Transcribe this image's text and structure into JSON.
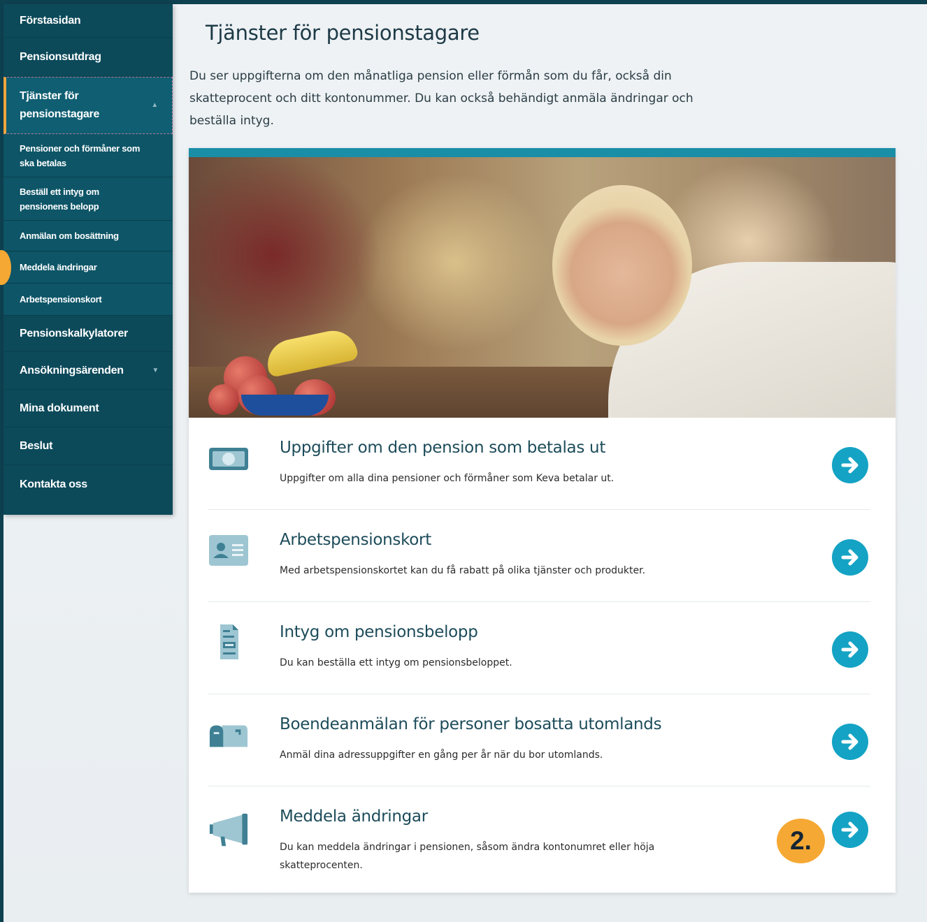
{
  "sidebar": {
    "items": [
      {
        "label": "Förstasidan"
      },
      {
        "label": "Pensionsutdrag"
      },
      {
        "label": "Tjänster för pensionstagare",
        "line1": "Tjänster för",
        "line2": "pensionstagare"
      },
      {
        "label": "Pensioner och förmåner som ska betalas",
        "line1": "Pensioner och förmåner som",
        "line2": "ska betalas"
      },
      {
        "label": "Beställ ett intyg om pensionens belopp",
        "line1": "Beställ ett intyg om",
        "line2": "pensionens belopp"
      },
      {
        "label": "Anmälan om bosättning"
      },
      {
        "label": "Meddela ändringar"
      },
      {
        "label": "Arbetspensionskort"
      },
      {
        "label": "Pensionskalkylatorer"
      },
      {
        "label": "Ansökningsärenden"
      },
      {
        "label": "Mina dokument"
      },
      {
        "label": "Beslut"
      },
      {
        "label": "Kontakta oss"
      }
    ]
  },
  "main": {
    "title": "Tjänster för pensionstagare",
    "intro": "Du ser uppgifterna om den månatliga pension eller förmån som du får, också din skatteprocent och ditt kontonummer. Du kan också behändigt anmäla ändringar och beställa intyg.",
    "services": [
      {
        "title": "Uppgifter om den pension som betalas ut",
        "desc": "Uppgifter om alla dina pensioner och förmåner som Keva betalar ut.",
        "icon": "banknote-icon"
      },
      {
        "title": "Arbetspensionskort",
        "desc": "Med arbetspensionskortet kan du få rabatt på olika tjänster och produkter.",
        "icon": "id-card-icon"
      },
      {
        "title": "Intyg om pensionsbelopp",
        "desc": "Du kan beställa ett intyg om pensionsbeloppet.",
        "icon": "document-icon"
      },
      {
        "title": "Boendeanmälan för personer bosatta utomlands",
        "desc": "Anmäl dina adressuppgifter en gång per år när du bor utomlands.",
        "icon": "mailbox-icon"
      },
      {
        "title": "Meddela ändringar",
        "desc": "Du kan meddela ändringar i pensionen, såsom ändra kontonumret eller höja skatteprocenten.",
        "icon": "megaphone-icon"
      }
    ]
  },
  "annotation": {
    "step_label": "2."
  },
  "colors": {
    "sidebar": "#0c4a5a",
    "accent": "#14a3c4",
    "highlight": "#f5a833",
    "topbar": "#1a8ea6"
  }
}
